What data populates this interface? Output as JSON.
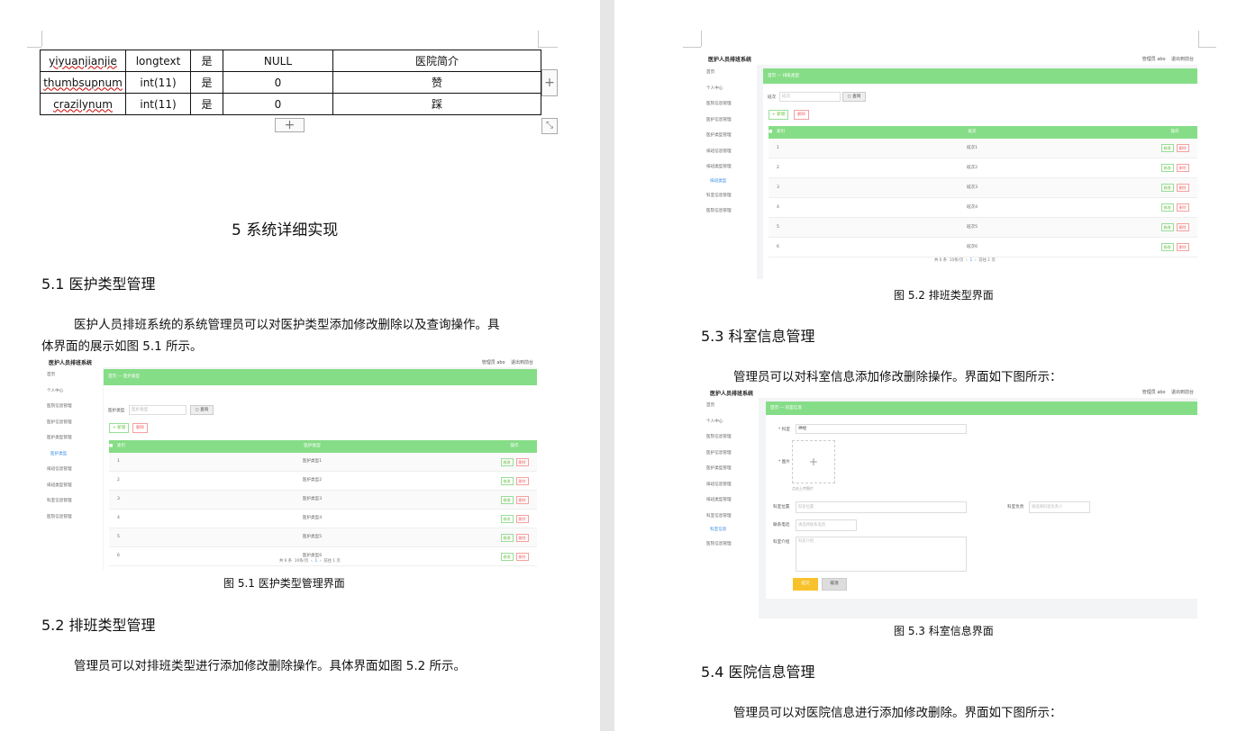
{
  "db_table": {
    "rows": [
      [
        "yiyuanjianjie",
        "longtext",
        "是",
        "NULL",
        "医院简介"
      ],
      [
        "thumbsupnum",
        "int(11)",
        "是",
        "0",
        "赞"
      ],
      [
        "crazilynum",
        "int(11)",
        "是",
        "0",
        "踩"
      ]
    ]
  },
  "left": {
    "chapter_title": "5 系统详细实现",
    "sec51_title": "5.1  医护类型管理",
    "sec51_para1": "医护人员排班系统的系统管理员可以对医护类型添加修改删除以及查询操作。具",
    "sec51_para2": "体界面的展示如图 5.1 所示。",
    "fig51_caption": "图 5.1  医护类型管理界面",
    "sec52_title": "5.2  排班类型管理",
    "sec52_para": "管理员可以对排班类型进行添加修改删除操作。具体界面如图 5.2 所示。"
  },
  "right": {
    "fig52_caption": "图 5.2  排班类型界面",
    "sec53_title": "5.3  科室信息管理",
    "sec53_para": "管理员可以对科室信息添加修改删除操作。界面如下图所示：",
    "fig53_caption": "图 5.3  科室信息界面",
    "sec54_title": "5.4  医院信息管理",
    "sec54_para": "管理员可以对医院信息进行添加修改删除。界面如下图所示："
  },
  "screens": {
    "brand": "医护人员排班系统",
    "user_info": "管理员 abo",
    "logout": "退出到前台",
    "add_btn": "+ 新增",
    "del_btn": "删除",
    "query_btn": "查询",
    "edit_btn": "修改",
    "row_del_btn": "删除",
    "op_header": "操作",
    "index_header": "索引",
    "pagination": {
      "total": "共 6 条",
      "per_page": "10条/页",
      "page": "1",
      "goto": "前往",
      "goto_page": "1",
      "page_unit": "页"
    },
    "fig51": {
      "sidebar": [
        "首页",
        "个人中心",
        "医院信息管理",
        "医护信息管理",
        "医护类型管理",
        "医护类型",
        "排班信息管理",
        "排班类型管理",
        "科室信息管理",
        "医院信息管理"
      ],
      "breadcrumb": "首页 — 医护类型",
      "filter_label": "医护类型",
      "filter_placeholder": "医护类型",
      "column": "医护类型",
      "rows": [
        "医护类型1",
        "医护类型2",
        "医护类型3",
        "医护类型4",
        "医护类型5",
        "医护类型6"
      ]
    },
    "fig52": {
      "sidebar": [
        "首页",
        "个人中心",
        "医院信息管理",
        "医护信息管理",
        "医护类型管理",
        "排班信息管理",
        "排班类型管理",
        "排班类型",
        "科室信息管理",
        "医院信息管理"
      ],
      "breadcrumb": "首页 — 排班类型",
      "filter_label": "班次",
      "filter_placeholder": "班次",
      "column": "班次",
      "rows": [
        "班次1",
        "班次2",
        "班次3",
        "班次4",
        "班次5",
        "班次6"
      ]
    },
    "fig53": {
      "sidebar": [
        "首页",
        "个人中心",
        "医院信息管理",
        "医护信息管理",
        "医护类型管理",
        "排班信息管理",
        "排班类型管理",
        "科室信息管理",
        "科室信息",
        "医院信息管理"
      ],
      "breadcrumb": "首页 — 科室信息",
      "label_dept": "* 科室",
      "value_dept": "神经",
      "label_image": "* 图片",
      "upload_hint": "点击上传图片",
      "label_location": "科室位置",
      "ph_location": "科室位置",
      "label_contact": "科室负责",
      "ph_contact": "请选择科室负责人",
      "label_phone": "联系电话",
      "ph_phone": "请选择联系电话",
      "label_intro": "科室介绍",
      "ph_intro": "科室介绍",
      "submit": "提交",
      "cancel": "取消"
    }
  }
}
